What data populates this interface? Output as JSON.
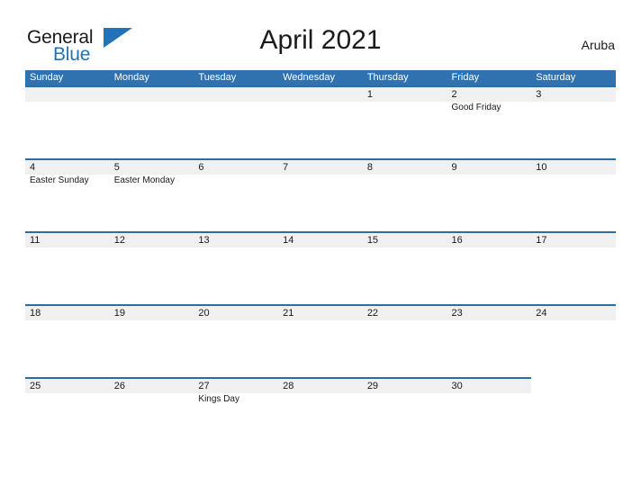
{
  "brand": {
    "name_part1": "General",
    "name_part2": "Blue",
    "logo_icon": "blue-flag-triangle",
    "color_dark": "#1a1a1a",
    "color_blue": "#2172b8"
  },
  "header": {
    "title": "April 2021",
    "country": "Aruba"
  },
  "theme": {
    "header_blue": "#3071b0",
    "divider_blue": "#2e6da4",
    "band_gray": "#f0f0f0",
    "text": "#1a1a1a",
    "header_text": "#ffffff"
  },
  "calendar": {
    "weekdays": [
      "Sunday",
      "Monday",
      "Tuesday",
      "Wednesday",
      "Thursday",
      "Friday",
      "Saturday"
    ],
    "weeks": [
      {
        "band_columns": 7,
        "days": [
          {
            "number": "",
            "event": ""
          },
          {
            "number": "",
            "event": ""
          },
          {
            "number": "",
            "event": ""
          },
          {
            "number": "",
            "event": ""
          },
          {
            "number": "1",
            "event": ""
          },
          {
            "number": "2",
            "event": "Good Friday"
          },
          {
            "number": "3",
            "event": ""
          }
        ]
      },
      {
        "band_columns": 7,
        "days": [
          {
            "number": "4",
            "event": "Easter Sunday"
          },
          {
            "number": "5",
            "event": "Easter Monday"
          },
          {
            "number": "6",
            "event": ""
          },
          {
            "number": "7",
            "event": ""
          },
          {
            "number": "8",
            "event": ""
          },
          {
            "number": "9",
            "event": ""
          },
          {
            "number": "10",
            "event": ""
          }
        ]
      },
      {
        "band_columns": 7,
        "days": [
          {
            "number": "11",
            "event": ""
          },
          {
            "number": "12",
            "event": ""
          },
          {
            "number": "13",
            "event": ""
          },
          {
            "number": "14",
            "event": ""
          },
          {
            "number": "15",
            "event": ""
          },
          {
            "number": "16",
            "event": ""
          },
          {
            "number": "17",
            "event": ""
          }
        ]
      },
      {
        "band_columns": 7,
        "days": [
          {
            "number": "18",
            "event": ""
          },
          {
            "number": "19",
            "event": ""
          },
          {
            "number": "20",
            "event": ""
          },
          {
            "number": "21",
            "event": ""
          },
          {
            "number": "22",
            "event": ""
          },
          {
            "number": "23",
            "event": ""
          },
          {
            "number": "24",
            "event": ""
          }
        ]
      },
      {
        "band_columns": 6,
        "days": [
          {
            "number": "25",
            "event": ""
          },
          {
            "number": "26",
            "event": ""
          },
          {
            "number": "27",
            "event": "Kings Day"
          },
          {
            "number": "28",
            "event": ""
          },
          {
            "number": "29",
            "event": ""
          },
          {
            "number": "30",
            "event": ""
          },
          {
            "number": "",
            "event": ""
          }
        ]
      }
    ]
  }
}
